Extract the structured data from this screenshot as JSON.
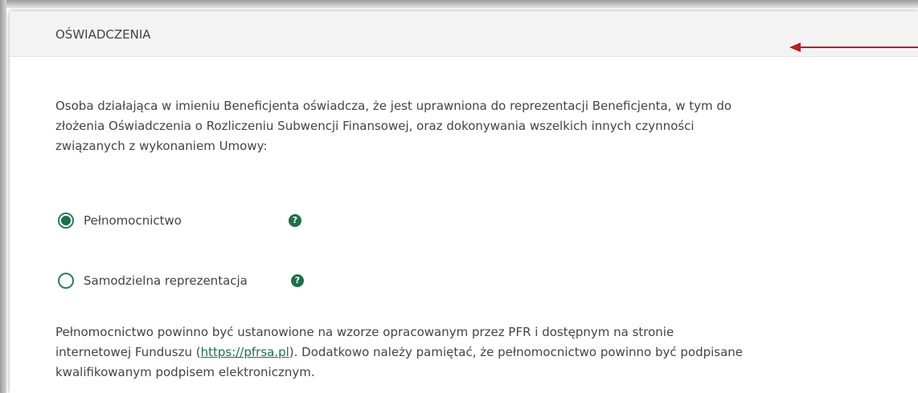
{
  "header": {
    "title": "OŚWIADCZENIA"
  },
  "intro": {
    "line1": "Osoba działająca w imieniu Beneficjenta oświadcza, że jest uprawniona do reprezentacji Beneficjenta, w tym do",
    "line2": "złożenia Oświadczenia o Rozliczeniu Subwencji Finansowej, oraz dokonywania wszelkich innych czynności",
    "line3": "związanych z wykonaniem Umowy:"
  },
  "options": [
    {
      "label": "Pełnomocnictwo",
      "selected": true,
      "help_icon": "question-circle-icon"
    },
    {
      "label": "Samodzielna reprezentacja",
      "selected": false,
      "help_icon": "question-circle-icon"
    }
  ],
  "help_glyph": "?",
  "note": {
    "line1": "Pełnomocnictwo powinno być ustanowione na wzorze opracowanym przez PFR i dostępnym na stronie",
    "line2_pre": "internetowej Funduszu (",
    "link": "https://pfrsa.pl",
    "line2_post": "). Dodatkowo należy pamiętać, że pełnomocnictwo powinno być podpisane",
    "line3": "kwalifikowanym podpisem elektronicznym."
  },
  "colors": {
    "accent": "#1f6e4c",
    "arrow": "#b3202a",
    "header_bg": "#f3f3f3"
  }
}
